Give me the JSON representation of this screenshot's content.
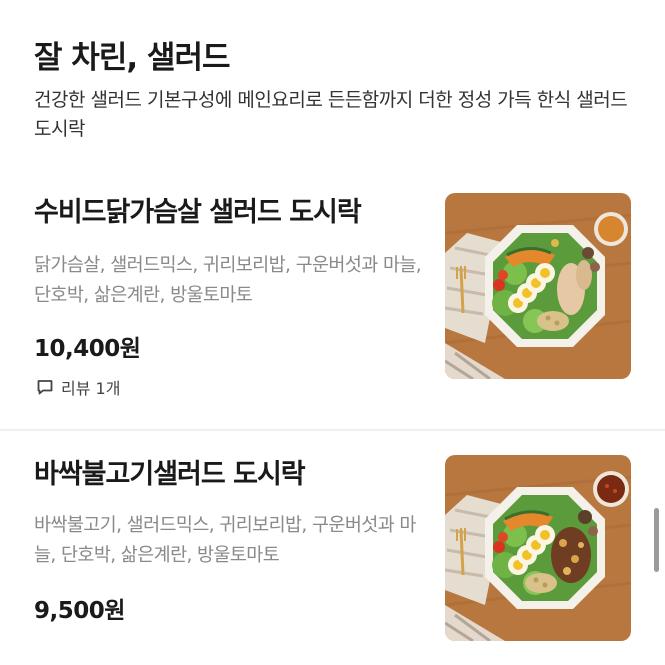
{
  "section": {
    "title": "잘 차린, 샐러드",
    "description": "건강한 샐러드 기본구성에 메인요리로 든든함까지 더한 정성 가득 한식 샐러드 도시락"
  },
  "items": [
    {
      "name": "수비드닭가슴살 샐러드 도시락",
      "description": "닭가슴살, 샐러드믹스, 귀리보리밥, 구운버섯과 마늘, 단호박, 삶은계란, 방울토마토",
      "price": "10,400원",
      "review": "리뷰 1개",
      "image_icon": "salad-bowl-chicken"
    },
    {
      "name": "바싹불고기샐러드 도시락",
      "description": "바싹불고기, 샐러드믹스, 귀리보리밥, 구운버섯과 마늘, 단호박, 삶은계란, 방울토마토",
      "price": "9,500원",
      "image_icon": "salad-bowl-bulgogi"
    }
  ],
  "colors": {
    "title": "#1a1a1a",
    "description": "#8a8a8a",
    "divider": "#f0f0f0",
    "wood": "#b5773f"
  }
}
